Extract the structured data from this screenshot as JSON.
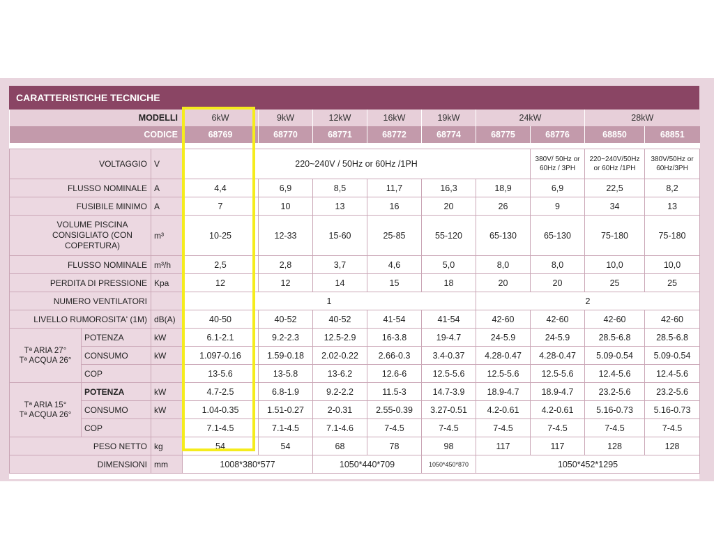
{
  "title": "CARATTERISTICHE TECNICHE",
  "colors": {
    "header": "#8a4564",
    "codice_bg": "#c39aab",
    "modelli_bg": "#e7cfd9",
    "label_bg": "#ecd8e1",
    "highlight": "#f5ec1d"
  },
  "header": {
    "modelli_label": "MODELLI",
    "codice_label": "CODICE",
    "models": [
      "6kW",
      "9kW",
      "12kW",
      "16kW",
      "19kW",
      "24kW",
      "28kW"
    ],
    "codes": [
      "68769",
      "68770",
      "68771",
      "68772",
      "68774",
      "68775",
      "68776",
      "68850",
      "68851"
    ]
  },
  "rows": {
    "voltaggio": {
      "label": "VOLTAGGIO",
      "unit": "V",
      "v1": "220~240V / 50Hz or 60Hz /1PH",
      "v2": "380V/ 50Hz or 60Hz / 3PH",
      "v3": "220~240V/50Hz or 60Hz /1PH",
      "v4": "380V/50Hz or 60Hz/3PH"
    },
    "flusso_nominale_a": {
      "label": "FLUSSO NOMINALE",
      "unit": "A",
      "values": [
        "4,4",
        "6,9",
        "8,5",
        "11,7",
        "16,3",
        "18,9",
        "6,9",
        "22,5",
        "8,2"
      ]
    },
    "fusibile": {
      "label": "FUSIBILE MINIMO",
      "unit": "A",
      "values": [
        "7",
        "10",
        "13",
        "16",
        "20",
        "26",
        "9",
        "34",
        "13"
      ]
    },
    "volume": {
      "label": "VOLUME PISCINA CONSIGLIATO (CON COPERTURA)",
      "unit": "m³",
      "values": [
        "10-25",
        "12-33",
        "15-60",
        "25-85",
        "55-120",
        "65-130",
        "65-130",
        "75-180",
        "75-180"
      ]
    },
    "flusso_nominale_m": {
      "label": "FLUSSO NOMINALE",
      "unit": "m³/h",
      "values": [
        "2,5",
        "2,8",
        "3,7",
        "4,6",
        "5,0",
        "8,0",
        "8,0",
        "10,0",
        "10,0"
      ]
    },
    "perdita": {
      "label": "PERDITA DI PRESSIONE",
      "unit": "Kpa",
      "values": [
        "12",
        "12",
        "14",
        "15",
        "18",
        "20",
        "20",
        "25",
        "25"
      ]
    },
    "ventilatori": {
      "label": "NUMERO VENTILATORI",
      "v1": "1",
      "v2": "2"
    },
    "rumorosita": {
      "label": "LIVELLO RUMOROSITA' (1M)",
      "unit": "dB(A)",
      "values": [
        "40-50",
        "40-52",
        "40-52",
        "41-54",
        "41-54",
        "42-60",
        "42-60",
        "42-60",
        "42-60"
      ]
    },
    "cond1": {
      "label_line1": "Tª ARIA 27°",
      "label_line2": "Tª ACQUA 26°",
      "potenza": {
        "label": "POTENZA",
        "unit": "kW",
        "values": [
          "6.1-2.1",
          "9.2-2.3",
          "12.5-2.9",
          "16-3.8",
          "19-4.7",
          "24-5.9",
          "24-5.9",
          "28.5-6.8",
          "28.5-6.8"
        ]
      },
      "consumo": {
        "label": "CONSUMO",
        "unit": "kW",
        "values": [
          "1.097-0.16",
          "1.59-0.18",
          "2.02-0.22",
          "2.66-0.3",
          "3.4-0.37",
          "4.28-0.47",
          "4.28-0.47",
          "5.09-0.54",
          "5.09-0.54"
        ]
      },
      "cop": {
        "label": "COP",
        "values": [
          "13-5.6",
          "13-5.8",
          "13-6.2",
          "12.6-6",
          "12.5-5.6",
          "12.5-5.6",
          "12.5-5.6",
          "12.4-5.6",
          "12.4-5.6"
        ]
      }
    },
    "cond2": {
      "label_line1": "Tª ARIA 15°",
      "label_line2": "Tª ACQUA 26°",
      "potenza": {
        "label": "POTENZA",
        "unit": "kW",
        "values": [
          "4.7-2.5",
          "6.8-1.9",
          "9.2-2.2",
          "11.5-3",
          "14.7-3.9",
          "18.9-4.7",
          "18.9-4.7",
          "23.2-5.6",
          "23.2-5.6"
        ]
      },
      "consumo": {
        "label": "CONSUMO",
        "unit": "kW",
        "values": [
          "1.04-0.35",
          "1.51-0.27",
          "2-0.31",
          "2.55-0.39",
          "3.27-0.51",
          "4.2-0.61",
          "4.2-0.61",
          "5.16-0.73",
          "5.16-0.73"
        ]
      },
      "cop": {
        "label": "COP",
        "values": [
          "7.1-4.5",
          "7.1-4.5",
          "7.1-4.6",
          "7-4.5",
          "7-4.5",
          "7-4.5",
          "7-4.5",
          "7-4.5",
          "7-4.5"
        ]
      }
    },
    "peso": {
      "label": "PESO NETTO",
      "unit": "kg",
      "values": [
        "54",
        "54",
        "68",
        "78",
        "98",
        "117",
        "117",
        "128",
        "128"
      ]
    },
    "dimensioni": {
      "label": "DIMENSIONI",
      "unit": "mm",
      "v1": "1008*380*577",
      "v2": "1050*440*709",
      "v3": "1050*450*870",
      "v4": "1050*452*1295"
    }
  }
}
